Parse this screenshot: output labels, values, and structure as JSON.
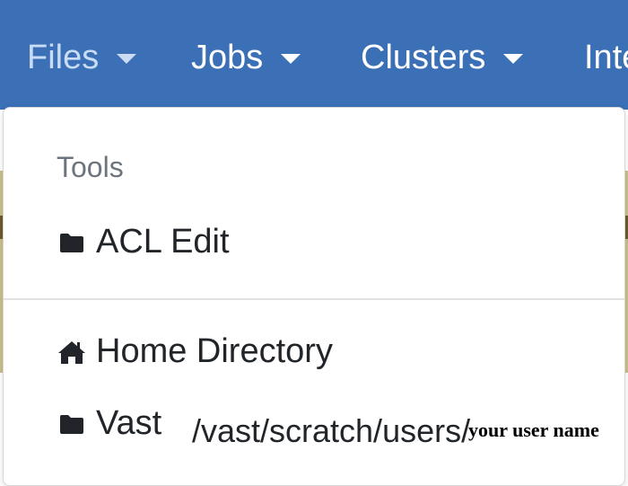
{
  "navbar": {
    "items": [
      {
        "label": "Files",
        "active": true
      },
      {
        "label": "Jobs",
        "active": false
      },
      {
        "label": "Clusters",
        "active": false
      },
      {
        "label": "Inte",
        "active": false
      }
    ]
  },
  "dropdown": {
    "header": "Tools",
    "items": [
      {
        "label": "ACL Edit",
        "icon": "folder-icon"
      },
      {
        "label": "Home Directory",
        "icon": "home-icon"
      },
      {
        "label": "Vast",
        "icon": "folder-icon"
      }
    ],
    "vast_path": "/vast/scratch/users/",
    "path_annotation": "your user name"
  },
  "colors": {
    "navbar_bg": "#3b6fb6",
    "active_nav_text": "#c9dcf4",
    "header_text": "#6c757d",
    "item_text": "#212529"
  }
}
